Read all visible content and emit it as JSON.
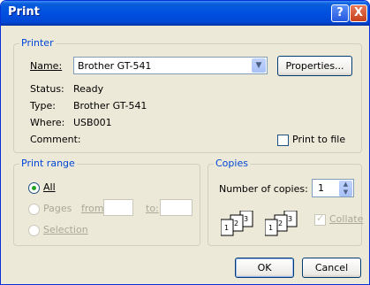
{
  "window": {
    "title": "Print"
  },
  "titlebar_buttons": {
    "help": "?",
    "close": "X"
  },
  "printer": {
    "legend": "Printer",
    "name_label": "Name:",
    "name_value": "Brother GT-541",
    "properties_button": "Properties...",
    "status_label": "Status:",
    "status_value": "Ready",
    "type_label": "Type:",
    "type_value": "Brother GT-541",
    "where_label": "Where:",
    "where_value": "USB001",
    "comment_label": "Comment:",
    "print_to_file_label": "Print to file",
    "print_to_file_checked": false
  },
  "print_range": {
    "legend": "Print range",
    "all_label": "All",
    "pages_label": "Pages",
    "from_label": "from:",
    "to_label": "to:",
    "selection_label": "Selection",
    "selected": "all"
  },
  "copies": {
    "legend": "Copies",
    "number_label": "Number of copies:",
    "number_value": "1",
    "collate_label": "Collate",
    "collate_checked": true,
    "collate_page_numbers": [
      "1",
      "2",
      "3"
    ]
  },
  "actions": {
    "ok": "OK",
    "cancel": "Cancel"
  },
  "icons": {
    "dropdown": "chevron-down-icon",
    "spin": "spin-arrows-icon",
    "collate": "collate-pages-icon",
    "check": "checkmark-icon",
    "help": "help-icon",
    "close": "close-icon"
  }
}
